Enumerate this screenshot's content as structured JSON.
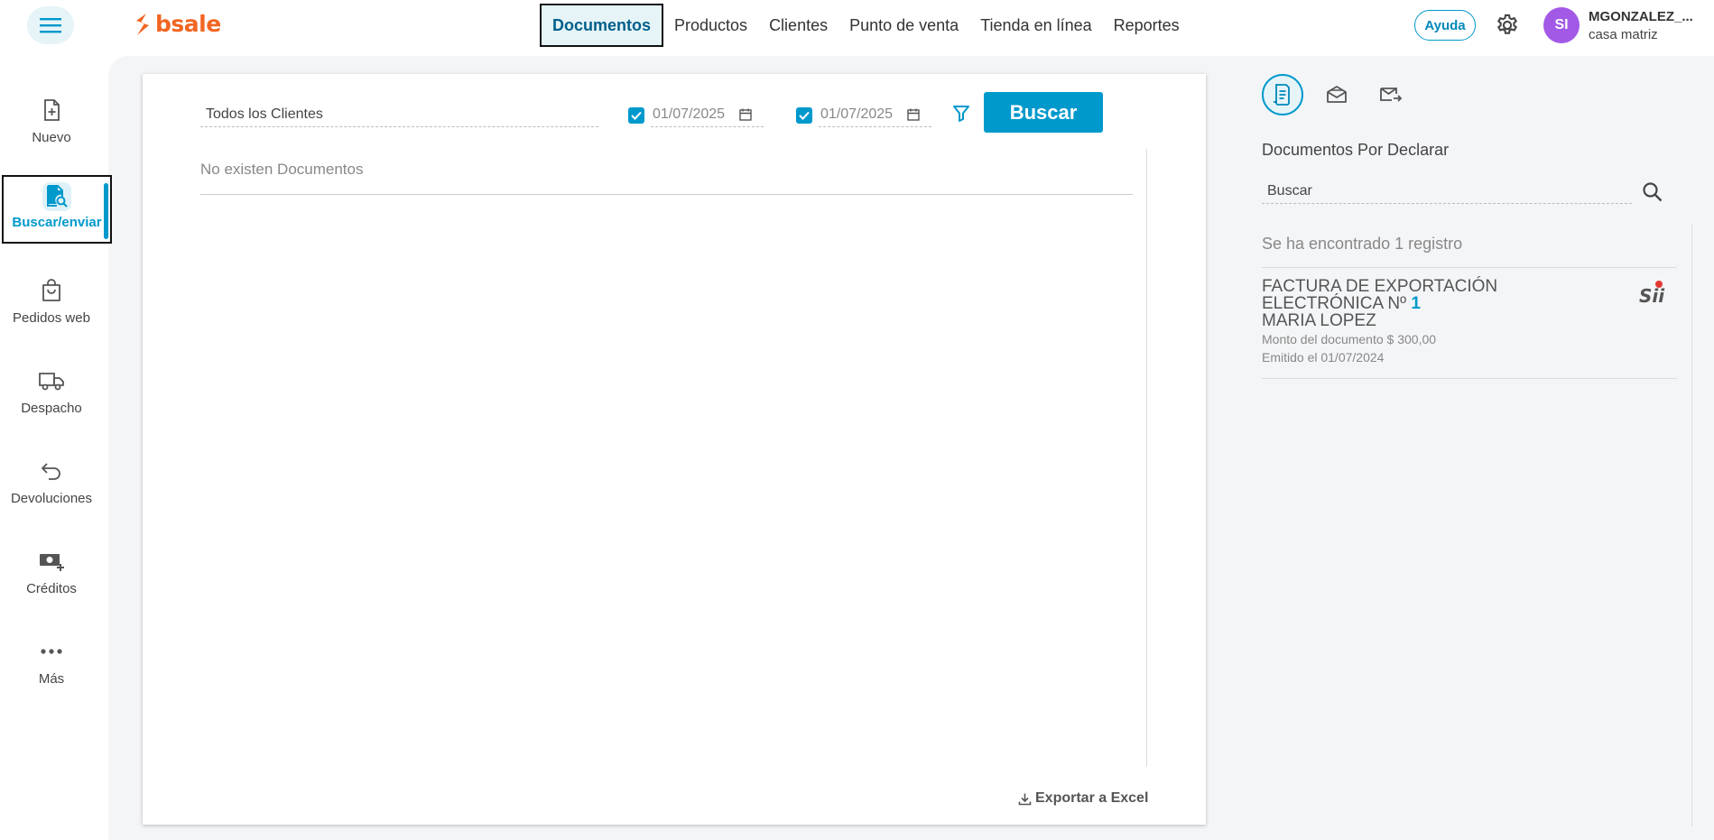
{
  "header": {
    "brand": "bsale",
    "nav": [
      {
        "label": "Documentos",
        "active": true
      },
      {
        "label": "Productos"
      },
      {
        "label": "Clientes"
      },
      {
        "label": "Punto de venta"
      },
      {
        "label": "Tienda en línea"
      },
      {
        "label": "Reportes"
      }
    ],
    "help_label": "Ayuda",
    "user": {
      "initials": "SI",
      "name": "MGONZALEZ_...",
      "branch": "casa matriz"
    }
  },
  "sidebar": {
    "items": [
      {
        "label": "Nuevo",
        "icon": "file-plus-icon"
      },
      {
        "label": "Buscar/enviar",
        "icon": "file-search-icon",
        "active": true
      },
      {
        "label": "Pedidos web",
        "icon": "shopping-bag-icon"
      },
      {
        "label": "Despacho",
        "icon": "truck-icon"
      },
      {
        "label": "Devoluciones",
        "icon": "return-arrow-icon"
      },
      {
        "label": "Créditos",
        "icon": "cash-plus-icon"
      },
      {
        "label": "Más",
        "icon": "more-dots-icon"
      }
    ]
  },
  "search": {
    "client_value": "Todos los Clientes",
    "date_from": "01/07/2025",
    "date_to": "01/07/2025",
    "button_label": "Buscar"
  },
  "results": {
    "empty_message": "No existen Documentos",
    "export_label": "Exportar a Excel"
  },
  "right_panel": {
    "title": "Documentos Por Declarar",
    "search_placeholder": "Buscar",
    "count_text": "Se ha encontrado 1 registro",
    "documents": [
      {
        "type": "FACTURA DE EXPORTACIÓN ELECTRÓNICA Nº",
        "number": "1",
        "client": "MARIA LOPEZ",
        "amount": "Monto del documento $ 300,00",
        "issued": "Emitido el 01/07/2024",
        "badge": "Sii"
      }
    ]
  },
  "colors": {
    "accent": "#0099cc",
    "brand": "#f26522",
    "avatar": "#a259e6"
  }
}
